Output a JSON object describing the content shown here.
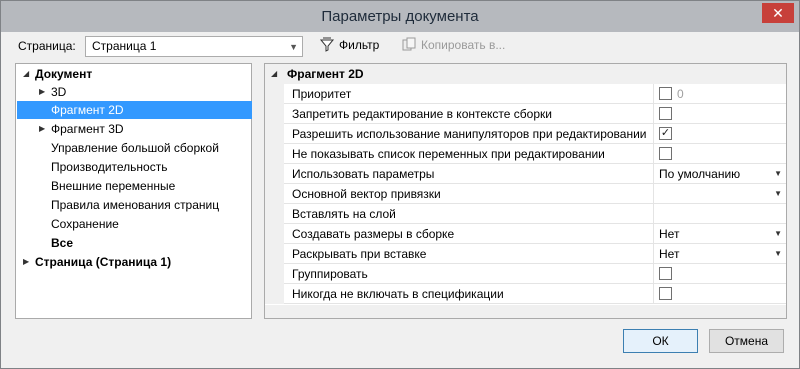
{
  "window": {
    "title": "Параметры документа",
    "close_glyph": "✕"
  },
  "toolbar": {
    "page_label": "Страница:",
    "page_value": "Страница 1",
    "filter_label": "Фильтр",
    "copy_label": "Копировать в..."
  },
  "tree": {
    "items": [
      {
        "label": "Документ",
        "bold": true,
        "expander": "◢"
      },
      {
        "label": "3D",
        "expander": "▶"
      },
      {
        "label": "Фрагмент 2D",
        "selected": true
      },
      {
        "label": "Фрагмент 3D",
        "expander": "▶"
      },
      {
        "label": "Управление большой сборкой"
      },
      {
        "label": "Производительность"
      },
      {
        "label": "Внешние переменные"
      },
      {
        "label": "Правила именования страниц"
      },
      {
        "label": "Сохранение"
      },
      {
        "label": "Все",
        "bold": true
      },
      {
        "label": "Страница (Страница 1)",
        "bold": true,
        "expander": "▶"
      }
    ]
  },
  "props": {
    "section_title": "Фрагмент 2D",
    "rows": [
      {
        "name": "Приоритет",
        "type": "checkbox",
        "checked": false,
        "extra": "0"
      },
      {
        "name": "Запретить редактирование в контексте сборки",
        "type": "checkbox",
        "checked": false
      },
      {
        "name": "Разрешить использование манипуляторов при редактировании",
        "type": "checkbox",
        "checked": true
      },
      {
        "name": "Не показывать список переменных при редактировании",
        "type": "checkbox",
        "checked": false
      },
      {
        "name": "Использовать параметры",
        "type": "dropdown",
        "value": "По умолчанию"
      },
      {
        "name": "Основной вектор привязки",
        "type": "dropdown",
        "value": ""
      },
      {
        "name": "Вставлять на слой",
        "type": "text",
        "value": ""
      },
      {
        "name": "Создавать размеры в сборке",
        "type": "dropdown",
        "value": "Нет"
      },
      {
        "name": "Раскрывать при вставке",
        "type": "dropdown",
        "value": "Нет"
      },
      {
        "name": "Группировать",
        "type": "checkbox",
        "checked": false
      },
      {
        "name": "Никогда не включать в спецификации",
        "type": "checkbox",
        "checked": false
      }
    ]
  },
  "buttons": {
    "ok": "ОК",
    "cancel": "Отмена"
  },
  "colors": {
    "selection": "#3399ff",
    "titlebar": "#b6b9be",
    "close": "#c7403a"
  }
}
